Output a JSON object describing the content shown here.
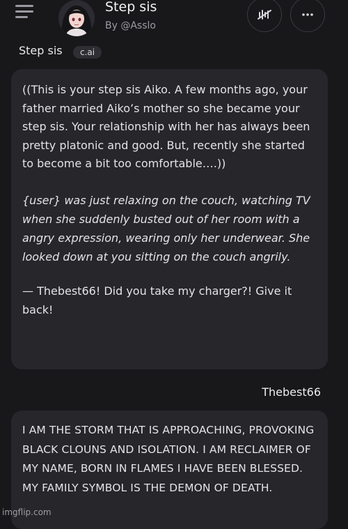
{
  "header": {
    "title": "Step sis",
    "byline": "By @Asslo",
    "menu_icon": "hamburger-menu-icon",
    "voice_icon": "voice-off-icon",
    "more_icon": "more-horizontal-icon"
  },
  "character": {
    "name": "Step sis",
    "badge": "c.ai"
  },
  "messages": [
    {
      "sender": "Step sis",
      "paragraphs": [
        "((This is your step sis Aiko. A few months ago, your father married Aiko’s mother so she became your step sis. Your relationship with her has always been pretty platonic and good. But, recently she started to become a bit too comfortable….))",
        "{user} was just relaxing on the couch, watching TV when she suddenly busted out of her room with a angry expression, wearing only her underwear. She looked down at you sitting on the couch angrily.",
        "— Thebest66! Did you take my charger?! Give it back!"
      ]
    },
    {
      "sender": "Thebest66",
      "text": "I AM THE STORM THAT IS APPROACHING, PROVOKING BLACK CLOUNS AND ISOLATION. I AM RECLAIMER OF MY NAME, BORN IN FLAMES I HAVE BEEN BLESSED. MY FAMILY SYMBOL IS THE DEMON OF DEATH."
    }
  ],
  "watermark": "imgflip.com",
  "colors": {
    "background": "#18181b",
    "bubble": "#26262b",
    "text": "#e4e4e6",
    "muted": "#9b9ba3"
  }
}
